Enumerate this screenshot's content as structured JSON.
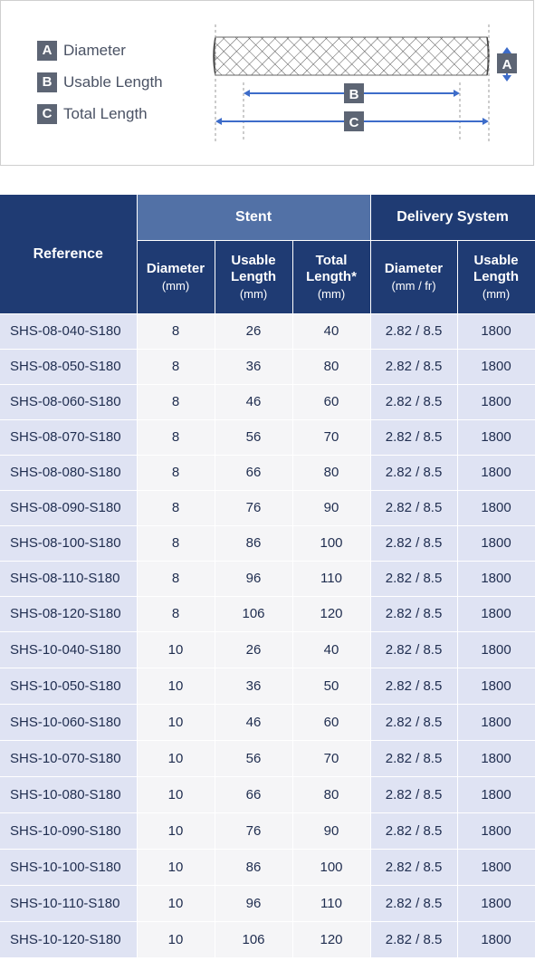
{
  "legend": [
    {
      "letter": "A",
      "label": "Diameter"
    },
    {
      "letter": "B",
      "label": "Usable Length"
    },
    {
      "letter": "C",
      "label": "Total Length"
    }
  ],
  "diagram": {
    "marker_a": "A",
    "marker_b": "B",
    "marker_c": "C"
  },
  "table": {
    "header": {
      "reference": "Reference",
      "stent": "Stent",
      "delivery_system": "Delivery System",
      "stent_diameter": "Diameter",
      "stent_diameter_unit": "(mm)",
      "stent_usable_length": "Usable Length",
      "stent_usable_length_unit": "(mm)",
      "stent_total_length": "Total Length*",
      "stent_total_length_unit": "(mm)",
      "ds_diameter": "Diameter",
      "ds_diameter_unit": "(mm / fr)",
      "ds_usable_length": "Usable Length",
      "ds_usable_length_unit": "(mm)"
    },
    "rows": [
      {
        "reference": "SHS-08-040-S180",
        "diameter": "8",
        "usable_length": "26",
        "total_length": "40",
        "ds_diameter": "2.82 / 8.5",
        "ds_usable_length": "1800"
      },
      {
        "reference": "SHS-08-050-S180",
        "diameter": "8",
        "usable_length": "36",
        "total_length": "80",
        "ds_diameter": "2.82 / 8.5",
        "ds_usable_length": "1800"
      },
      {
        "reference": "SHS-08-060-S180",
        "diameter": "8",
        "usable_length": "46",
        "total_length": "60",
        "ds_diameter": "2.82 / 8.5",
        "ds_usable_length": "1800"
      },
      {
        "reference": "SHS-08-070-S180",
        "diameter": "8",
        "usable_length": "56",
        "total_length": "70",
        "ds_diameter": "2.82 / 8.5",
        "ds_usable_length": "1800"
      },
      {
        "reference": "SHS-08-080-S180",
        "diameter": "8",
        "usable_length": "66",
        "total_length": "80",
        "ds_diameter": "2.82 / 8.5",
        "ds_usable_length": "1800"
      },
      {
        "reference": "SHS-08-090-S180",
        "diameter": "8",
        "usable_length": "76",
        "total_length": "90",
        "ds_diameter": "2.82 / 8.5",
        "ds_usable_length": "1800"
      },
      {
        "reference": "SHS-08-100-S180",
        "diameter": "8",
        "usable_length": "86",
        "total_length": "100",
        "ds_diameter": "2.82 / 8.5",
        "ds_usable_length": "1800"
      },
      {
        "reference": "SHS-08-110-S180",
        "diameter": "8",
        "usable_length": "96",
        "total_length": "110",
        "ds_diameter": "2.82 / 8.5",
        "ds_usable_length": "1800"
      },
      {
        "reference": "SHS-08-120-S180",
        "diameter": "8",
        "usable_length": "106",
        "total_length": "120",
        "ds_diameter": "2.82 / 8.5",
        "ds_usable_length": "1800"
      },
      {
        "reference": "SHS-10-040-S180",
        "diameter": "10",
        "usable_length": "26",
        "total_length": "40",
        "ds_diameter": "2.82 / 8.5",
        "ds_usable_length": "1800"
      },
      {
        "reference": "SHS-10-050-S180",
        "diameter": "10",
        "usable_length": "36",
        "total_length": "50",
        "ds_diameter": "2.82 / 8.5",
        "ds_usable_length": "1800"
      },
      {
        "reference": "SHS-10-060-S180",
        "diameter": "10",
        "usable_length": "46",
        "total_length": "60",
        "ds_diameter": "2.82 / 8.5",
        "ds_usable_length": "1800"
      },
      {
        "reference": "SHS-10-070-S180",
        "diameter": "10",
        "usable_length": "56",
        "total_length": "70",
        "ds_diameter": "2.82 / 8.5",
        "ds_usable_length": "1800"
      },
      {
        "reference": "SHS-10-080-S180",
        "diameter": "10",
        "usable_length": "66",
        "total_length": "80",
        "ds_diameter": "2.82 / 8.5",
        "ds_usable_length": "1800"
      },
      {
        "reference": "SHS-10-090-S180",
        "diameter": "10",
        "usable_length": "76",
        "total_length": "90",
        "ds_diameter": "2.82 / 8.5",
        "ds_usable_length": "1800"
      },
      {
        "reference": "SHS-10-100-S180",
        "diameter": "10",
        "usable_length": "86",
        "total_length": "100",
        "ds_diameter": "2.82 / 8.5",
        "ds_usable_length": "1800"
      },
      {
        "reference": "SHS-10-110-S180",
        "diameter": "10",
        "usable_length": "96",
        "total_length": "110",
        "ds_diameter": "2.82 / 8.5",
        "ds_usable_length": "1800"
      },
      {
        "reference": "SHS-10-120-S180",
        "diameter": "10",
        "usable_length": "106",
        "total_length": "120",
        "ds_diameter": "2.82 / 8.5",
        "ds_usable_length": "1800"
      }
    ]
  },
  "colors": {
    "header_dark": "#1f3b73",
    "header_light": "#5271a6",
    "cell_tint": "#dfe3f3",
    "cell_plain": "#f5f5f7",
    "legend_badge": "#5d6574",
    "arrow_blue": "#3d6cc9"
  }
}
